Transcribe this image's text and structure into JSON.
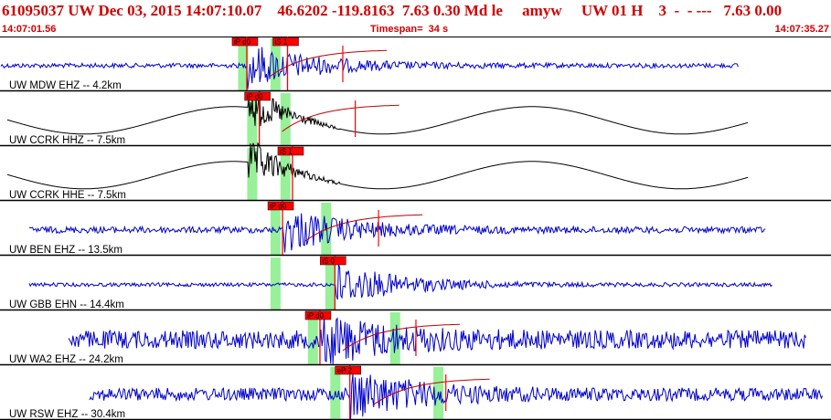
{
  "header": {
    "title": "61095037 UW Dec 03, 2015 14:07:10.07    46.6202 -119.8163  7.63 0.30 Md le     amyw     UW 01 H    3  -  - ---   7.63 0.00",
    "start_time": "14:07:01.56",
    "timespan": "Timespan=  34 s",
    "end_time": "14:07:35.27"
  },
  "colors": {
    "header_text": "#d00000",
    "trace_blue": "#0000cc",
    "trace_black": "#000000",
    "pick_box": "#ff0000",
    "pick_window": "#98f098",
    "coda_curve": "#c00000",
    "separator": "#000000"
  },
  "traces": [
    {
      "label": "UW MDW EHZ -- 4.2km",
      "color": "blue",
      "style": "noise",
      "picks": [
        {
          "label": "iP d0",
          "t": 0.297
        },
        {
          "label": "iS 1",
          "t": 0.346
        }
      ],
      "green_windows": [
        0.292,
        0.331
      ],
      "coda": true
    },
    {
      "label": "UW CCRK HHZ -- 7.5km",
      "color": "black",
      "style": "sine",
      "picks": [
        {
          "label": "iP d0",
          "t": 0.312
        }
      ],
      "green_windows": [
        0.303,
        0.343
      ],
      "coda": true
    },
    {
      "label": "UW CCRK HHE -- 7.5km",
      "color": "black",
      "style": "sine",
      "picks": [
        {
          "label": "iS 1",
          "t": 0.352
        }
      ],
      "green_windows": [
        0.303,
        0.343
      ],
      "coda": false
    },
    {
      "label": "UW BEN EHZ -- 13.5km",
      "color": "blue",
      "style": "noise",
      "picks": [
        {
          "label": "iP d0",
          "t": 0.34
        }
      ],
      "green_windows": [
        0.331,
        0.392
      ],
      "coda": true
    },
    {
      "label": "UW GBB EHN -- 14.4km",
      "color": "blue",
      "style": "noise",
      "picks": [
        {
          "label": "iS 0",
          "t": 0.403
        }
      ],
      "green_windows": [
        0.331,
        0.397
      ],
      "coda": false
    },
    {
      "label": "UW WA2 EHZ -- 24.2km",
      "color": "blue",
      "style": "noise",
      "picks": [
        {
          "label": "iP d0",
          "t": 0.385
        }
      ],
      "green_windows": [
        0.376,
        0.475
      ],
      "coda": true
    },
    {
      "label": "UW RSW EHZ -- 30.4km",
      "color": "blue",
      "style": "noise",
      "picks": [
        {
          "label": "eP 2",
          "t": 0.421
        }
      ],
      "green_windows": [
        0.403,
        0.527
      ],
      "coda": true
    }
  ]
}
